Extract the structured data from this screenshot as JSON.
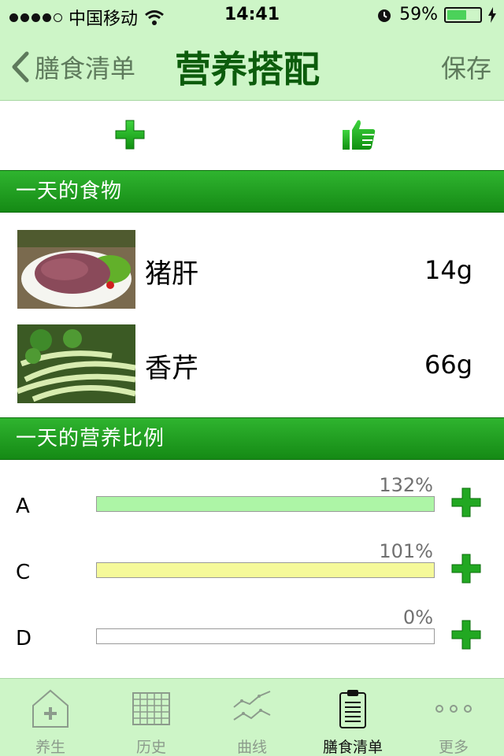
{
  "status_bar": {
    "carrier": "中国移动",
    "time": "14:41",
    "battery": "59%",
    "battery_level": 0.59
  },
  "nav": {
    "back_label": "膳食清单",
    "title": "营养搭配",
    "save_label": "保存"
  },
  "sections": {
    "foods_header": "一天的食物",
    "nutrition_header": "一天的营养比例"
  },
  "foods": [
    {
      "name": "猪肝",
      "amount": "14g",
      "image": "pork-liver-photo"
    },
    {
      "name": "香芹",
      "amount": "66g",
      "image": "celery-photo"
    }
  ],
  "nutrients": [
    {
      "letter": "A",
      "percent_label": "132%",
      "value": 132,
      "color": "#adf5a6"
    },
    {
      "letter": "C",
      "percent_label": "101%",
      "value": 101,
      "color": "#f5f99a"
    },
    {
      "letter": "D",
      "percent_label": "0%",
      "value": 0,
      "color": "#ffffff"
    }
  ],
  "tabs": [
    {
      "label": "养生",
      "icon": "home-plus-icon",
      "active": false
    },
    {
      "label": "历史",
      "icon": "calendar-grid-icon",
      "active": false
    },
    {
      "label": "曲线",
      "icon": "chart-line-icon",
      "active": false
    },
    {
      "label": "膳食清单",
      "icon": "clipboard-list-icon",
      "active": true
    },
    {
      "label": "更多",
      "icon": "more-dots-icon",
      "active": false
    }
  ],
  "colors": {
    "accent": "#1a9a1a",
    "nav_bg": "#cdf5c7",
    "title": "#0c5c0c"
  }
}
